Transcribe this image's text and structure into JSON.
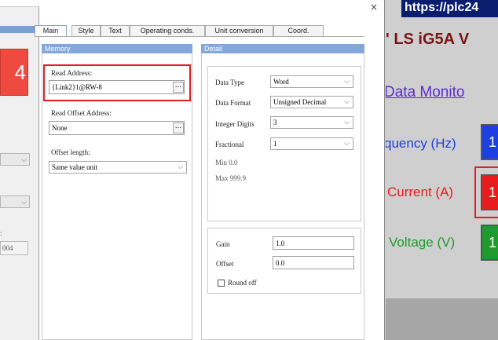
{
  "left_panel": {
    "tile_value": "4",
    "fragment_label": ":",
    "fragment_value": "004"
  },
  "dialog": {
    "tabs": [
      {
        "label": "Main"
      },
      {
        "label": "Style"
      },
      {
        "label": "Text"
      },
      {
        "label": "Operating conds."
      },
      {
        "label": "Unit conversion"
      },
      {
        "label": "Coord."
      }
    ],
    "memory": {
      "title": "Memory",
      "read_address_label": "Read Address:",
      "read_address_value": "{Link2}1@RW-8",
      "read_offset_label": "Read Offset Address:",
      "read_offset_value": "None",
      "offset_length_label": "Offset length:",
      "offset_length_value": "Same value unit",
      "browse_label": "..."
    },
    "detail": {
      "title": "Detail",
      "data_type_label": "Data Type",
      "data_type_value": "Word",
      "data_format_label": "Data Format",
      "data_format_value": "Unsigned Decimal",
      "integer_digits_label": "Integer Digits",
      "integer_digits_value": "3",
      "fractional_label": "Fractional",
      "fractional_value": "1",
      "min_text": "Min 0.0",
      "max_text": "Max 999.9",
      "gain_label": "Gain",
      "gain_value": "1.0",
      "offset_label": "Offset",
      "offset_value": "0.0",
      "round_off_label": "Round off"
    },
    "close_glyph": "×"
  },
  "background_page": {
    "url_text": "https://plc24",
    "heading": "' LS iG5A V",
    "monitor_link": "Data Monito",
    "rows": [
      {
        "label": "quency (Hz)",
        "value": "1",
        "color": "#1b3fe0"
      },
      {
        "label": "Current (A)",
        "value": "1",
        "color": "#e81c1c"
      },
      {
        "label": "Voltage (V)",
        "value": "1",
        "color": "#1f9b2e"
      }
    ]
  },
  "colors": {
    "highlight": "#e21d25",
    "section_header": "#84a7d9",
    "heading": "#7a1414",
    "link": "#5d2bd6"
  }
}
